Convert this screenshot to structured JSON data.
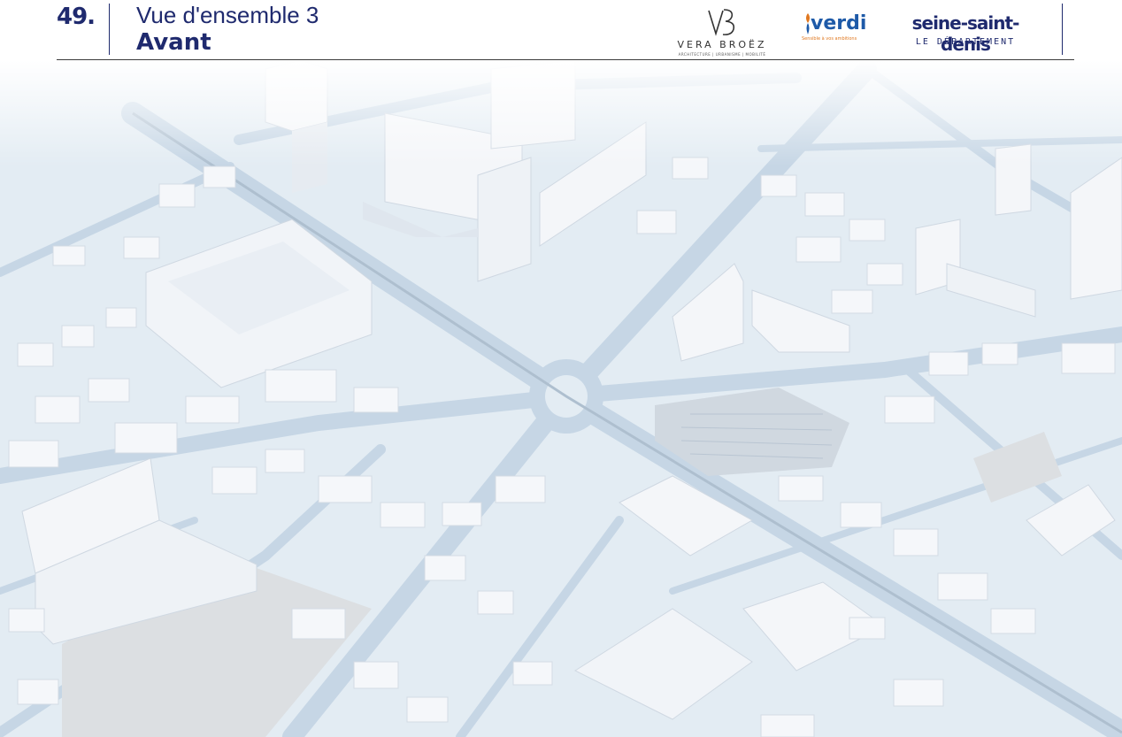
{
  "header": {
    "page_number": "49.",
    "title": "Vue d'ensemble 3",
    "subtitle": "Avant"
  },
  "logos": {
    "vera_broez": {
      "name": "VERA BROËZ",
      "tagline": "ARCHITECTURE | URBANISME | MOBILITÉ"
    },
    "verdi": {
      "name": "verdi",
      "tagline": "Sensible à vos ambitions"
    },
    "seine_saint_denis": {
      "name": "seine-saint-denis",
      "tagline": "LE DÉPARTEMENT"
    }
  },
  "colors": {
    "brand_navy": "#1f2a6e",
    "verdi_blue": "#1e5aa8",
    "verdi_orange": "#e07820",
    "road": "#c7d6e4",
    "ground": "#e4edf3",
    "building": "#f3f5f8"
  }
}
